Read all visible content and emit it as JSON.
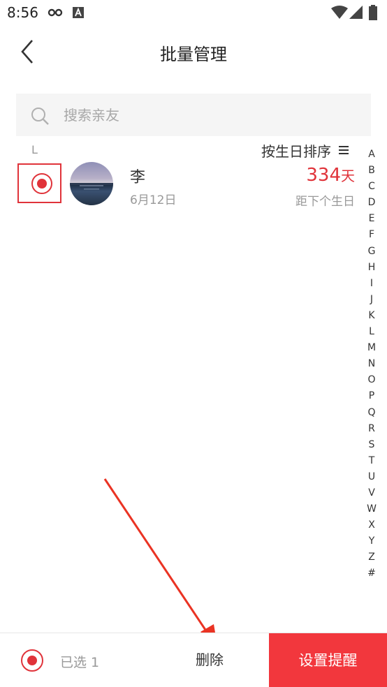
{
  "status_bar": {
    "time": "8:56",
    "icons": [
      "glasses-icon",
      "font-a-icon",
      "wifi-icon",
      "signal-icon",
      "battery-icon"
    ]
  },
  "header": {
    "title": "批量管理",
    "back_icon": "chevron-left-icon"
  },
  "search": {
    "placeholder": "搜索亲友",
    "value": "",
    "icon": "search-icon"
  },
  "list": {
    "group_letter": "L",
    "sort_label": "按生日排序",
    "sort_icon": "menu-lines-icon",
    "contacts": [
      {
        "name": "李",
        "birthday": "6月12日",
        "days_count": "334",
        "days_unit": "天",
        "days_caption": "距下个生日",
        "selected": true
      }
    ]
  },
  "alphabet_index": [
    "A",
    "B",
    "C",
    "D",
    "E",
    "F",
    "G",
    "H",
    "I",
    "J",
    "K",
    "L",
    "M",
    "N",
    "O",
    "P",
    "Q",
    "R",
    "S",
    "T",
    "U",
    "V",
    "W",
    "X",
    "Y",
    "Z",
    "#"
  ],
  "bottom_bar": {
    "selected_label": "已选 1",
    "delete_label": "删除",
    "reminder_label": "设置提醒"
  },
  "colors": {
    "accent": "#e0333a",
    "reminder_button": "#f2373d",
    "search_background": "#f5f5f5",
    "muted_text": "#999999"
  }
}
